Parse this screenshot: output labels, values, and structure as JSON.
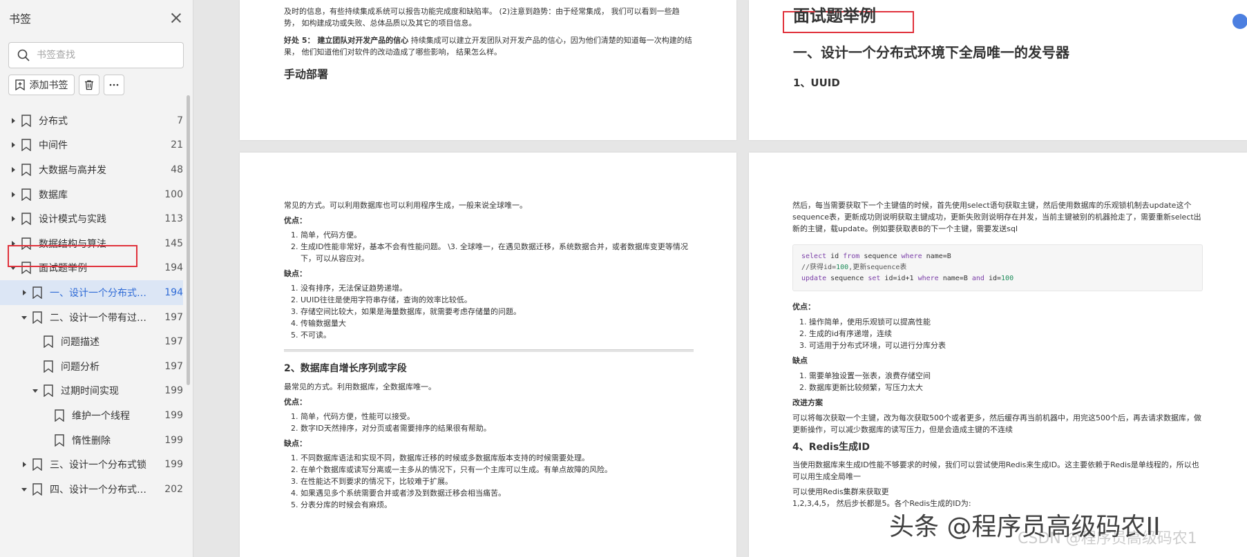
{
  "sidebar": {
    "title": "书签",
    "search_placeholder": "书签查找",
    "add_bookmark_label": "添加书签",
    "items": [
      {
        "label": "分布式",
        "page": "7"
      },
      {
        "label": "中间件",
        "page": "21"
      },
      {
        "label": "大数据与高并发",
        "page": "48"
      },
      {
        "label": "数据库",
        "page": "100"
      },
      {
        "label": "设计模式与实践",
        "page": "113"
      },
      {
        "label": "数据结构与算法",
        "page": "145"
      },
      {
        "label": "面试题举例",
        "page": "194"
      },
      {
        "label": "一、设计一个分布式环...",
        "page": "194"
      },
      {
        "label": "二、设计一个带有过期...",
        "page": "197"
      },
      {
        "label": "问题描述",
        "page": "197"
      },
      {
        "label": "问题分析",
        "page": "197"
      },
      {
        "label": "过期时间实现",
        "page": "199"
      },
      {
        "label": "维护一个线程",
        "page": "199"
      },
      {
        "label": "惰性删除",
        "page": "199"
      },
      {
        "label": "三、设计一个分布式锁",
        "page": "199"
      },
      {
        "label": "四、设计一个分布式环...",
        "page": "202"
      }
    ]
  },
  "page_tl": {
    "p1": "及时的信息，有些持续集成系统可以报告功能完成度和缺陷率。 (2)注意到趋势：由于经常集成， 我们可以看到一些趋势， 如构建成功或失败、总体品质以及其它的项目信息。",
    "p2_bold": "好处 5：  建立团队对开发产品的信心",
    "p2": " 持续集成可以建立开发团队对开发产品的信心，因为他们清楚的知道每一次构建的结果， 他们知道他们对软件的改动造成了哪些影响， 结果怎么样。",
    "heading": "手动部署"
  },
  "page_tr": {
    "title": "面试题举例",
    "h1": "一、设计一个分布式环境下全局唯一的发号器",
    "h2": "1、UUID"
  },
  "page_bl": {
    "intro": "常见的方式。可以利用数据库也可以利用程序生成，一般来说全球唯一。",
    "pros_label": "优点：",
    "pros": [
      "简单，代码方便。",
      "生成ID性能非常好，基本不会有性能问题。 \\3. 全球唯一，在遇见数据迁移，系统数据合并，或者数据库变更等情况下，可以从容应对。"
    ],
    "cons_label": "缺点：",
    "cons": [
      "没有排序，无法保证趋势递增。",
      "UUID往往是使用字符串存储，查询的效率比较低。",
      "存储空间比较大，如果是海量数据库，就需要考虑存储量的问题。",
      "传输数据量大",
      "不可读。"
    ],
    "h2": "2、数据库自增长序列或字段",
    "intro2": "最常见的方式。利用数据库，全数据库唯一。",
    "pros2_label": "优点：",
    "pros2": [
      "简单，代码方便，性能可以接受。",
      "数字ID天然排序，对分页或者需要排序的结果很有帮助。"
    ],
    "cons2_label": "缺点：",
    "cons2": [
      "不同数据库语法和实现不同，数据库迁移的时候或多数据库版本支持的时候需要处理。",
      "在单个数据库或读写分离或一主多从的情况下，只有一个主库可以生成。有单点故障的风险。",
      "在性能达不到要求的情况下，比较难于扩展。",
      "如果遇见多个系统需要合并或者涉及到数据迁移会相当痛苦。",
      "分表分库的时候会有麻烦。"
    ]
  },
  "page_br": {
    "intro": "然后，每当需要获取下一个主键值的时候，首先使用select语句获取主键，然后使用数据库的乐观锁机制去update这个sequence表，更新成功则说明获取主键成功，更新失败则说明存在并发，当前主键被别的机器抢走了，需要重新select出新的主键，载update。例如要获取表B的下一个主键，需要发送sql",
    "code_line1_kw1": "select",
    "code_line1_a": " id ",
    "code_line1_kw2": "from",
    "code_line1_b": " sequence ",
    "code_line1_kw3": "where",
    "code_line1_c": " name=B",
    "code_line2_a": "//获得id=",
    "code_line2_num": "100",
    "code_line2_b": ",更新sequence表",
    "code_line3_kw1": "update",
    "code_line3_a": " sequence ",
    "code_line3_kw2": "set",
    "code_line3_b": " id=id+1 ",
    "code_line3_kw3": "where",
    "code_line3_c": " name=B ",
    "code_line3_kw4": "and",
    "code_line3_d": " id=",
    "code_line3_num": "100",
    "pros_label": "优点：",
    "pros": [
      "操作简单，使用乐观锁可以提高性能",
      "生成的id有序递增，连续",
      "可适用于分布式环境，可以进行分库分表"
    ],
    "cons_label": "缺点",
    "cons": [
      "需要单独设置一张表，浪费存储空间",
      "数据库更新比较频繁，写压力太大"
    ],
    "improve_label": "改进方案",
    "improve": "可以将每次获取一个主键，改为每次获取500个或者更多，然后缓存再当前机器中，用完这500个后，再去请求数据库，做更新操作，可以减少数据库的读写压力，但是会造成主键的不连续",
    "h2": "4、Redis生成ID",
    "redis1": "当使用数据库来生成ID性能不够要求的时候，我们可以尝试使用Redis来生成ID。这主要依赖于Redis是单线程的，所以也可以用生成全局唯一",
    "redis2": "可以使用Redis集群来获取更",
    "redis3": "1,2,3,4,5， 然后步长都是5。各个Redis生成的ID为:"
  },
  "watermark": {
    "main": "头条 @程序员高级码农II",
    "sub": "CSDN @程序员高级码农1"
  }
}
